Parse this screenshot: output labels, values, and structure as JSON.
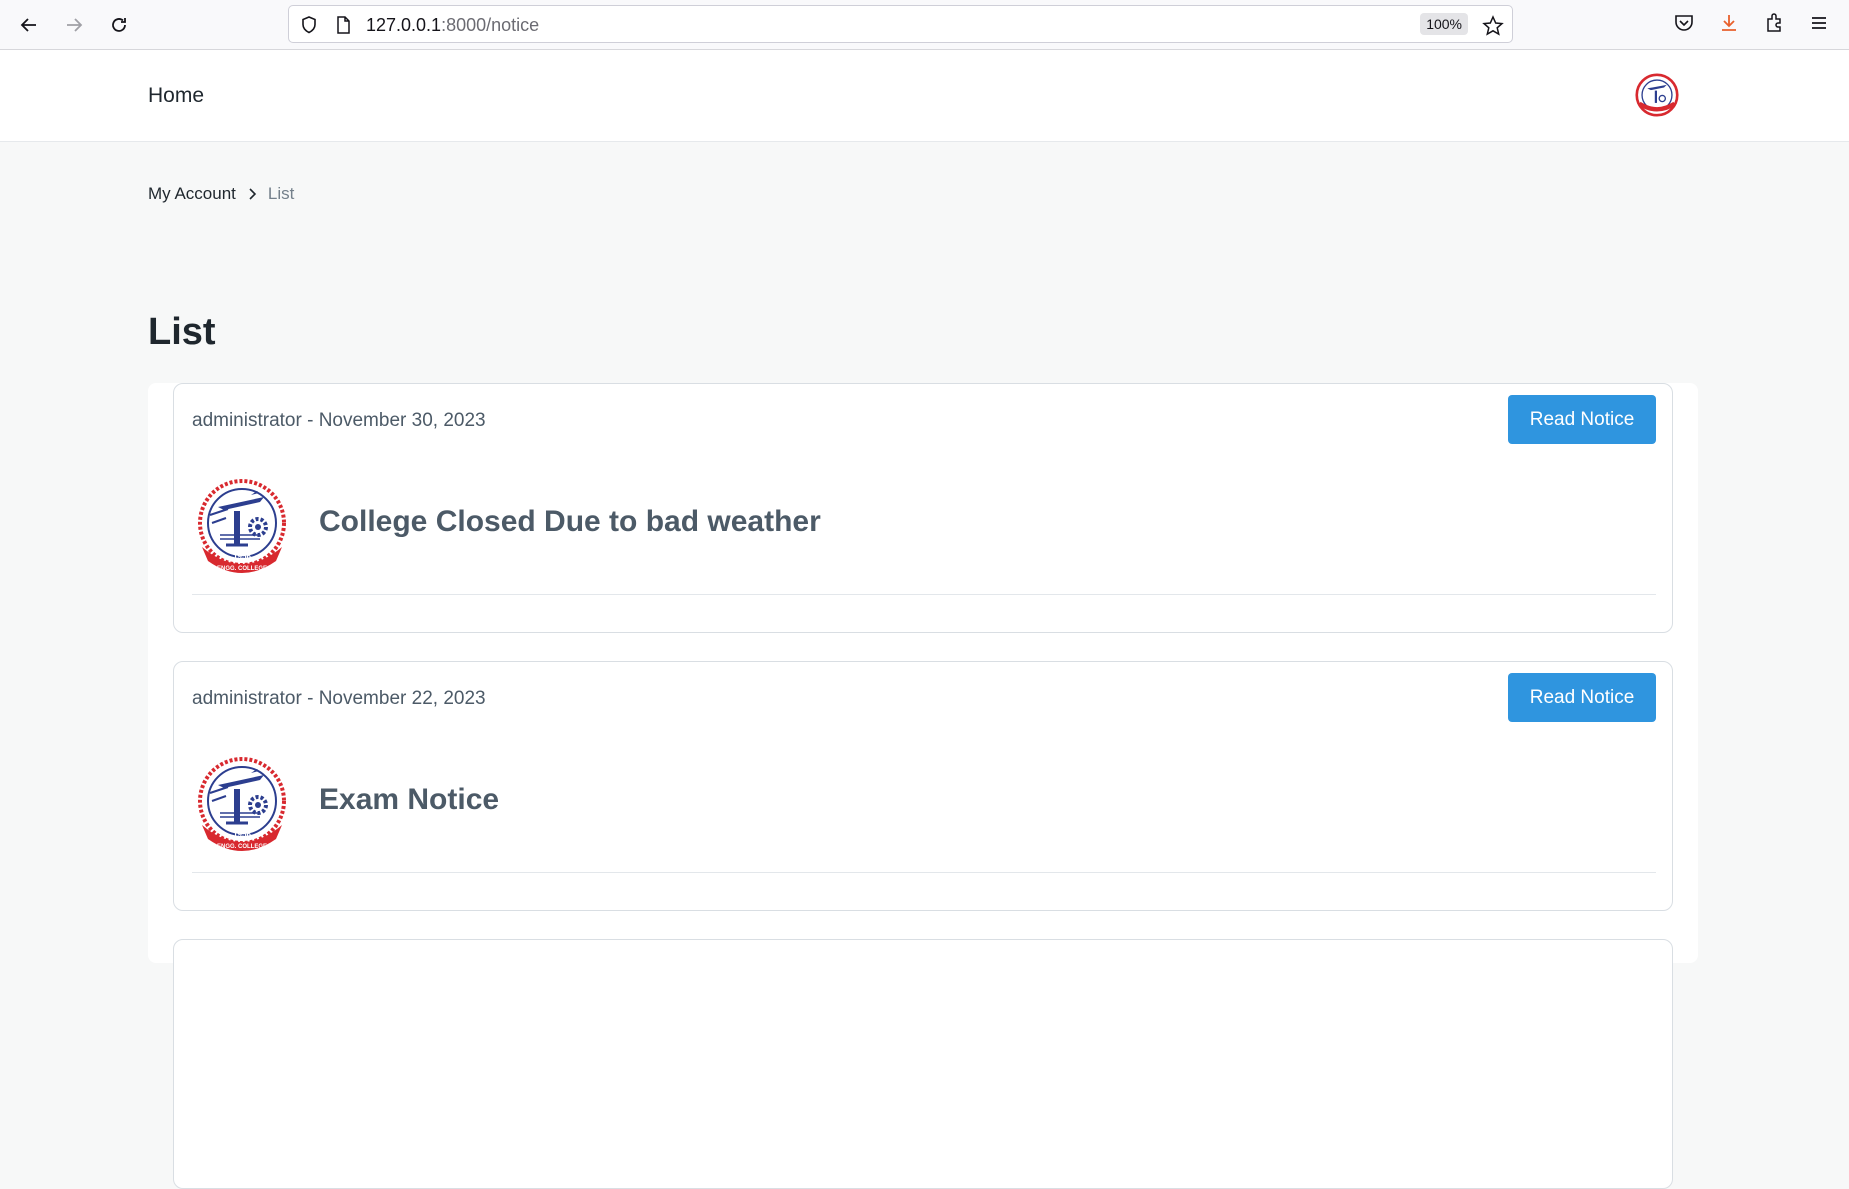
{
  "browser": {
    "url_host": "127.0.0.1",
    "url_path": ":8000/notice",
    "zoom": "100%"
  },
  "navbar": {
    "home_label": "Home"
  },
  "breadcrumb": {
    "items": [
      "My Account"
    ],
    "current": "List"
  },
  "page": {
    "title": "List"
  },
  "notices": [
    {
      "meta": "administrator - November 30, 2023",
      "title": "College Closed Due to bad weather",
      "button": "Read Notice"
    },
    {
      "meta": "administrator - November 22, 2023",
      "title": "Exam Notice",
      "button": "Read Notice"
    }
  ],
  "colors": {
    "accent": "#2f95df",
    "logo_red": "#d8292f",
    "logo_blue": "#2c3e8f"
  },
  "logo_text": {
    "top": "GURU NANAK DEV",
    "year": "1956",
    "bottom": "ENGG. COLLEGE"
  }
}
